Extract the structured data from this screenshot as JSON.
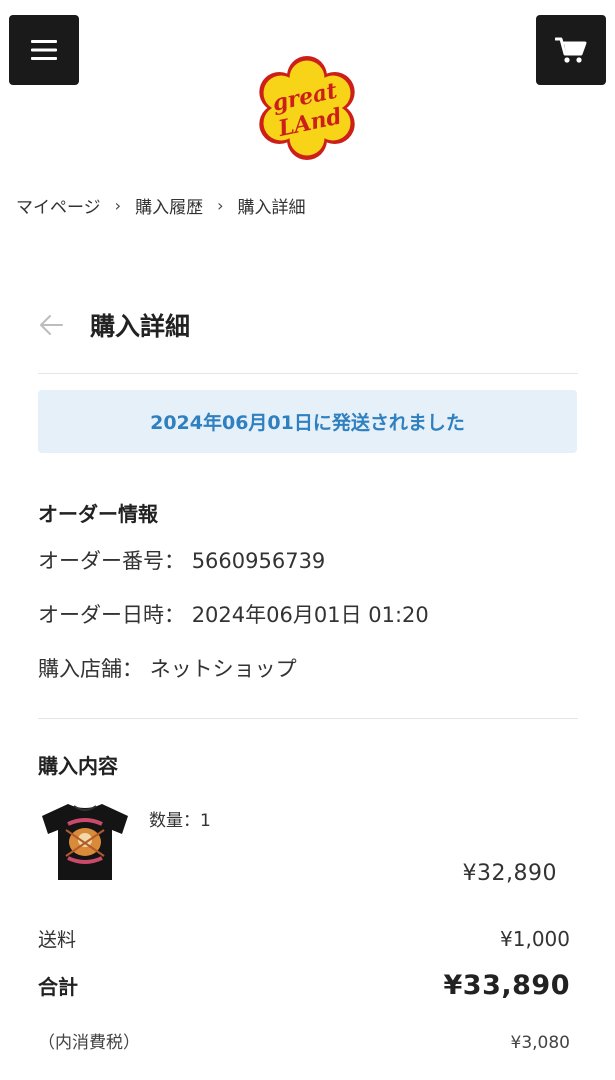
{
  "header": {
    "logo_text_top": "great",
    "logo_text_bottom": "LAnd",
    "menu_icon": "hamburger-menu-icon",
    "cart_icon": "shopping-cart-icon"
  },
  "breadcrumb": {
    "items": [
      "マイページ",
      "購入履歴",
      "購入詳細"
    ],
    "separator": "›"
  },
  "page": {
    "title": "購入詳細",
    "status_message": "2024年06月01日に発送されました"
  },
  "order_info": {
    "heading": "オーダー情報",
    "number_label": "オーダー番号：",
    "number_value": "5660956739",
    "date_label": "オーダー日時：",
    "date_value": "2024年06月01日 01:20",
    "store_label": "購入店舗：",
    "store_value": "ネットショップ"
  },
  "purchase": {
    "heading": "購入内容",
    "quantity_text": "数量：1",
    "item_price": "¥32,890"
  },
  "summary": {
    "shipping_label": "送料",
    "shipping_value": "¥1,000",
    "total_label": "合計",
    "total_value": "¥33,890",
    "tax_label": "（内消費税）",
    "tax_value": "¥3,080"
  },
  "colors": {
    "status_bg": "#e6f0f8",
    "status_text": "#2f80c0",
    "button_bg": "#1a1a1a",
    "logo_yellow": "#f7d417",
    "logo_red": "#cc1f1a"
  }
}
